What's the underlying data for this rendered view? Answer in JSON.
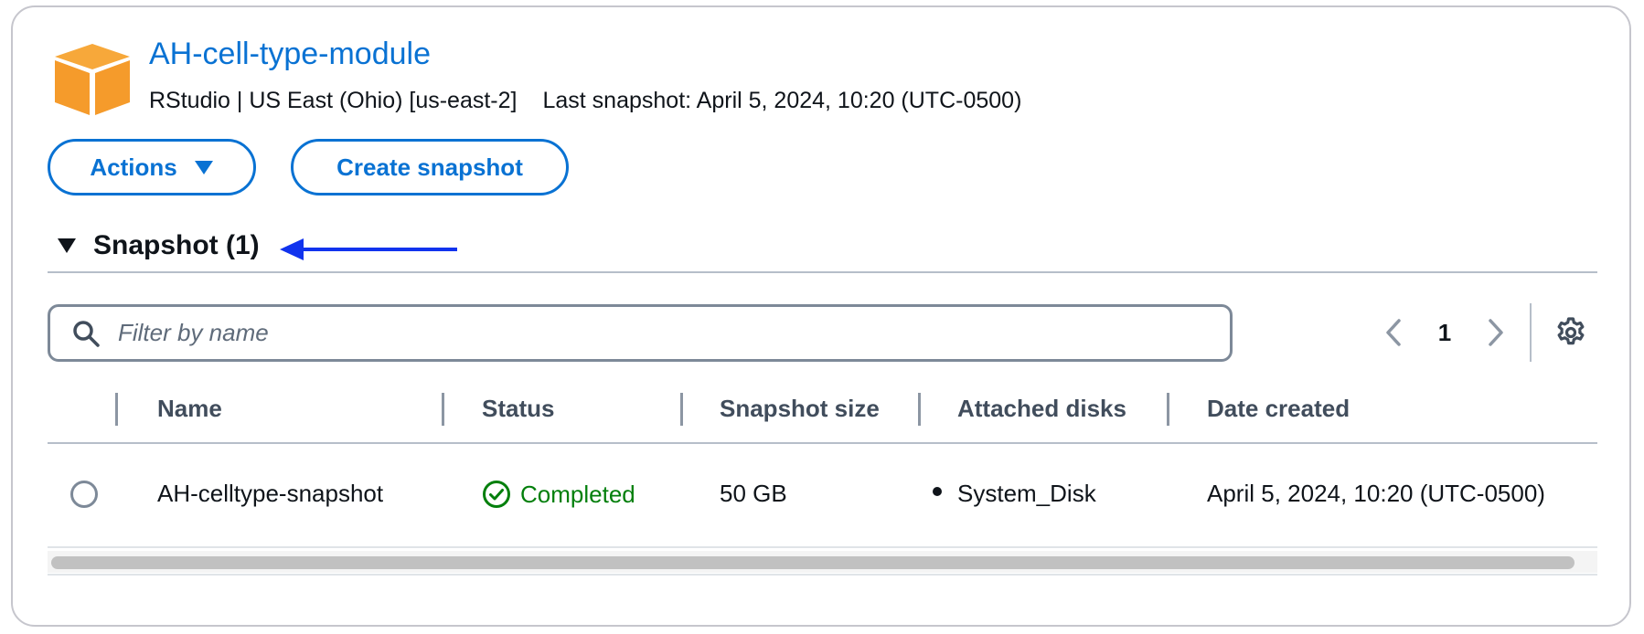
{
  "header": {
    "title": "AH-cell-type-module",
    "instance_type": "RStudio | US East (Ohio) [us-east-2]",
    "last_snapshot": "Last snapshot: April 5, 2024, 10:20 (UTC-0500)",
    "logo_color": "#f59b2b"
  },
  "toolbar": {
    "actions_label": "Actions",
    "create_snapshot_label": "Create snapshot"
  },
  "section": {
    "title": "Snapshot (1)",
    "annotation_arrow_color": "#1133ee"
  },
  "filter": {
    "placeholder": "Filter by name",
    "value": ""
  },
  "pagination": {
    "current_page": "1"
  },
  "table": {
    "columns": [
      "Name",
      "Status",
      "Snapshot size",
      "Attached disks",
      "Date created"
    ],
    "rows": [
      {
        "name": "AH-celltype-snapshot",
        "status": "Completed",
        "size": "50 GB",
        "attached_disks": [
          "System_Disk"
        ],
        "date_created": "April 5, 2024, 10:20 (UTC-0500)"
      }
    ]
  },
  "colors": {
    "link": "#0972d3",
    "status_success": "#037f0c"
  }
}
